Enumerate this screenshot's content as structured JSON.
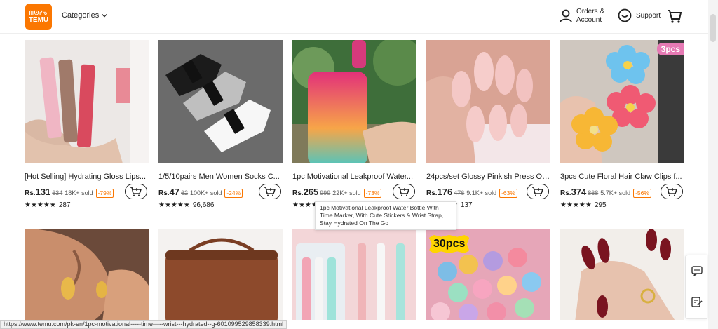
{
  "header": {
    "logo_line1": "ᗰᘎᓯᓀ",
    "logo_line2": "TEMU",
    "categories_label": "Categories",
    "orders_line1": "Orders &",
    "orders_line2": "Account",
    "support_label": "Support"
  },
  "products": [
    {
      "title": "[Hot Selling] Hydrating Gloss Lips...",
      "currency": "Rs.",
      "price": "131",
      "orig": "634",
      "sold": "18K+ sold",
      "discount": "-79%",
      "stars": "★★★★★",
      "reviews": "287"
    },
    {
      "title": "1/5/10pairs Men Women Socks C...",
      "currency": "Rs.",
      "price": "47",
      "orig": "62",
      "sold": "100K+ sold",
      "discount": "-24%",
      "stars": "★★★★★",
      "reviews": "96,686"
    },
    {
      "title": "1pc Motivational Leakproof Water...",
      "currency": "Rs.",
      "price": "265",
      "orig": "999",
      "sold": "22K+ sold",
      "discount": "-73%",
      "stars": "★★★★★",
      "reviews": ""
    },
    {
      "title": "24pcs/set Glossy Pinkish Press On...",
      "currency": "Rs.",
      "price": "176",
      "orig": "476",
      "sold": "9.1K+ sold",
      "discount": "-63%",
      "stars": "★★★★★",
      "reviews": "137"
    },
    {
      "title": "3pcs Cute Floral Hair Claw Clips f...",
      "currency": "Rs.",
      "price": "374",
      "orig": "868",
      "sold": "5.7K+ sold",
      "discount": "-56%",
      "stars": "★★★★★",
      "reviews": "295"
    }
  ],
  "badges": {
    "hair_clip": "3pcs",
    "mini_clips": "30pcs"
  },
  "tooltip": "1pc Motivational Leakproof Water Bottle With Time Marker, With Cute Stickers & Wrist Strap, Stay Hydrated On The Go",
  "status_url": "https://www.temu.com/pk-en/1pc-motivational-----time-----wrist---hydrated--g-601099529858339.html",
  "colors": {
    "brand": "#fb7701"
  }
}
